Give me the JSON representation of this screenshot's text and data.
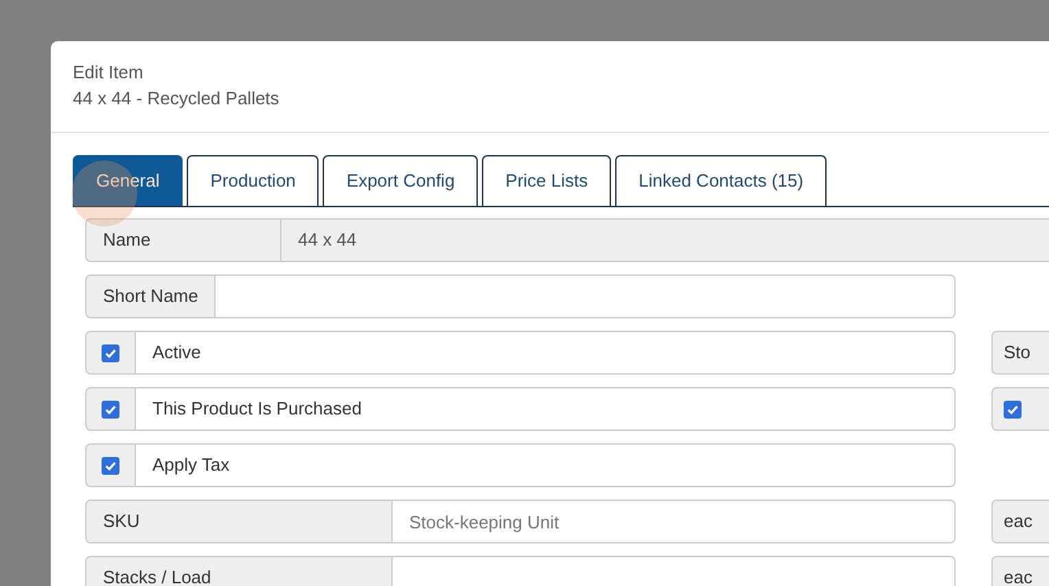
{
  "dialog": {
    "title": "Edit Item",
    "subtitle": "44 x 44 - Recycled Pallets"
  },
  "tabs": [
    {
      "label": "General",
      "selected": true
    },
    {
      "label": "Production",
      "selected": false
    },
    {
      "label": "Export Config",
      "selected": false
    },
    {
      "label": "Price Lists",
      "selected": false
    },
    {
      "label": "Linked Contacts (15)",
      "selected": false
    }
  ],
  "rows": [
    {
      "kind": "full",
      "label": "Name",
      "value": "44 x 44"
    },
    {
      "kind": "inline",
      "label": "Short Name"
    },
    {
      "kind": "checkbox",
      "label": "Active",
      "checked": true,
      "side": {
        "kind": "addon",
        "label": "Sto"
      }
    },
    {
      "kind": "checkbox",
      "label": "This Product Is Purchased",
      "checked": true,
      "side": {
        "kind": "checkbox",
        "checked": true
      }
    },
    {
      "kind": "checkbox",
      "label": "Apply Tax",
      "checked": true
    },
    {
      "kind": "split",
      "label": "SKU",
      "placeholder": "Stock-keeping Unit",
      "side": {
        "kind": "addon",
        "label": "eac"
      }
    },
    {
      "kind": "split",
      "label": "Stacks / Load",
      "side": {
        "kind": "addon",
        "label": "eac"
      }
    }
  ]
}
